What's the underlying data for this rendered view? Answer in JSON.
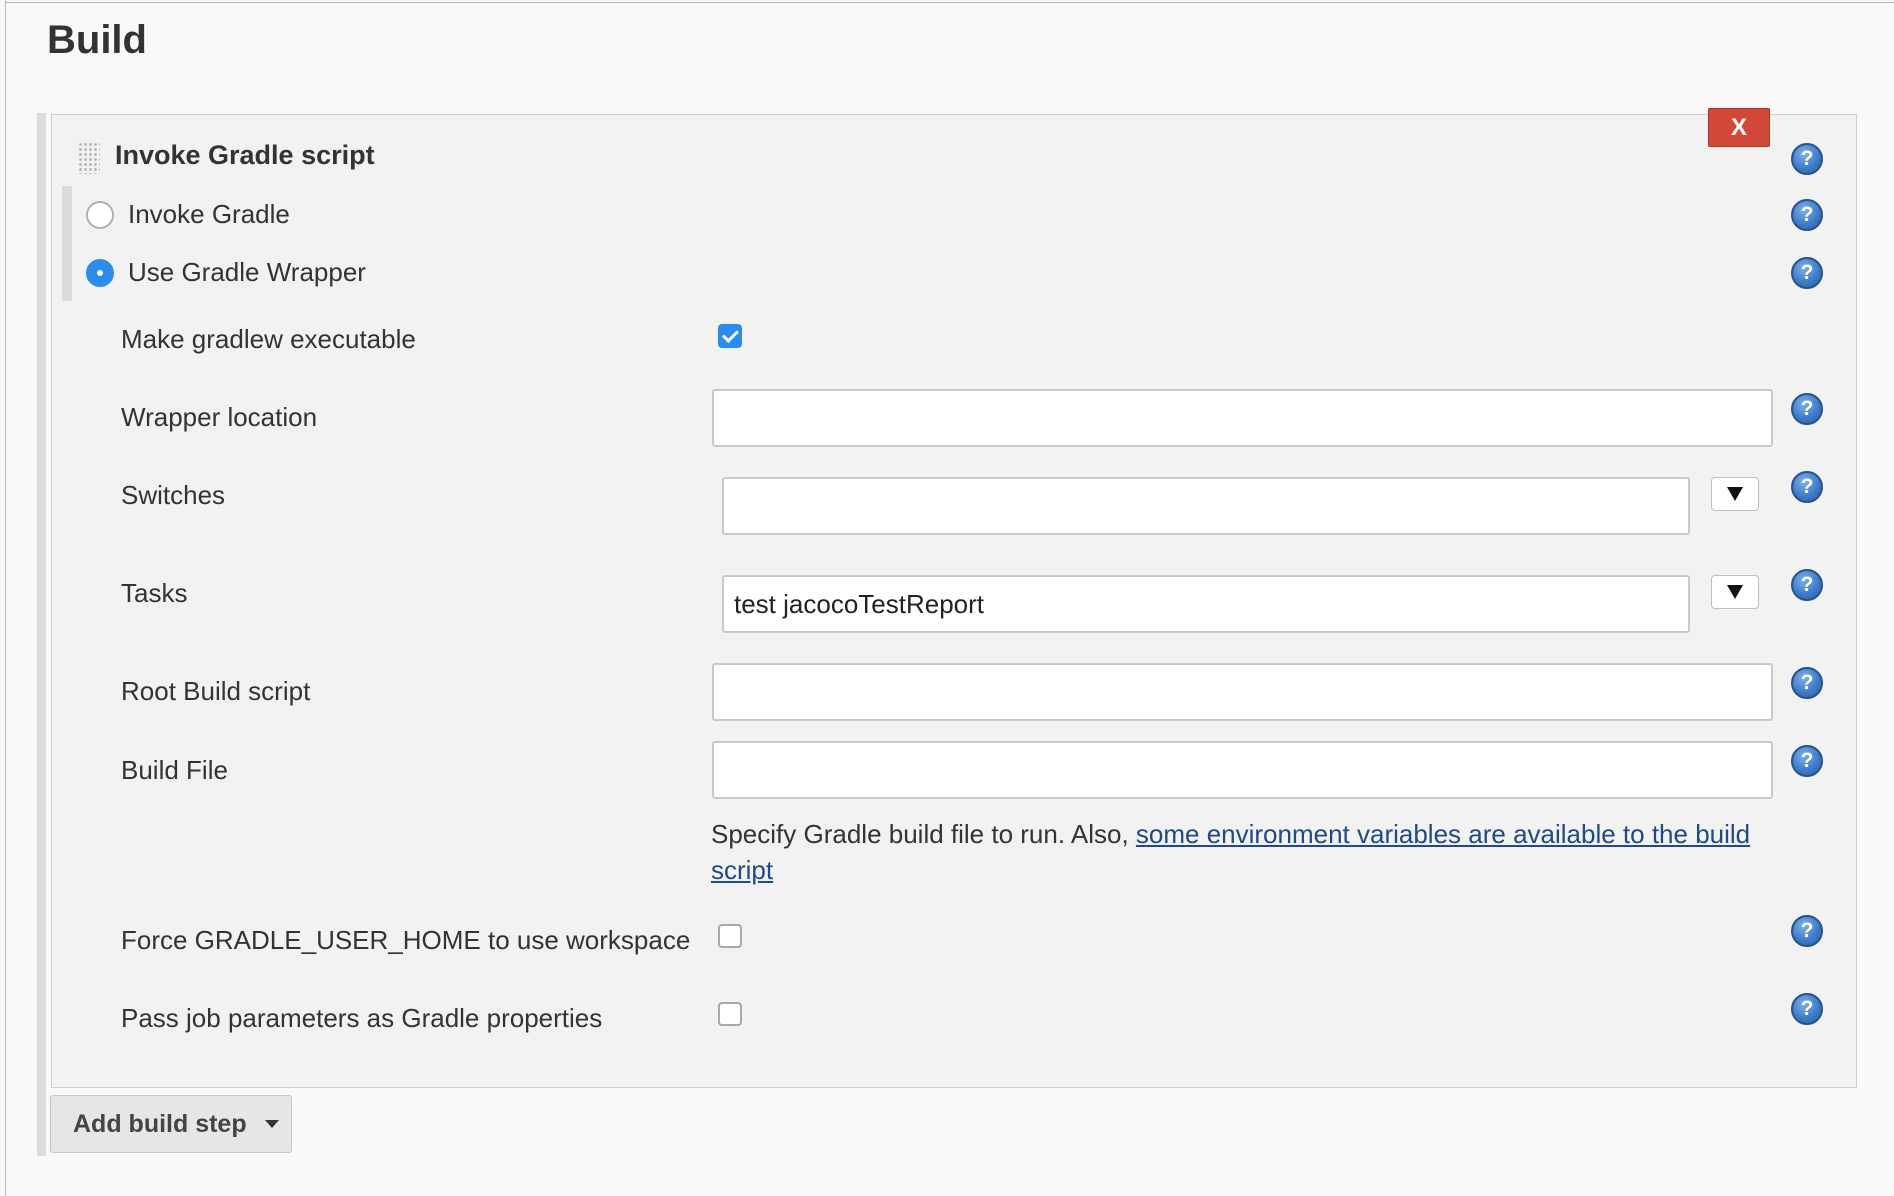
{
  "section": {
    "title": "Build"
  },
  "build_step": {
    "title": "Invoke Gradle script",
    "delete_label": "X",
    "help_symbol": "?",
    "radio_options": [
      {
        "label": "Invoke Gradle",
        "checked": false
      },
      {
        "label": "Use Gradle Wrapper",
        "checked": true
      }
    ],
    "fields": {
      "make_gradlew_executable": {
        "label": "Make gradlew executable",
        "checked": true
      },
      "wrapper_location": {
        "label": "Wrapper location",
        "value": ""
      },
      "switches": {
        "label": "Switches",
        "value": ""
      },
      "tasks": {
        "label": "Tasks",
        "value": "test jacocoTestReport"
      },
      "root_build_script": {
        "label": "Root Build script",
        "value": ""
      },
      "build_file": {
        "label": "Build File",
        "value": ""
      },
      "force_gradle_user_home": {
        "label": "Force GRADLE_USER_HOME to use workspace",
        "checked": false
      },
      "pass_job_parameters": {
        "label": "Pass job parameters as Gradle properties",
        "checked": false
      }
    },
    "build_file_help": {
      "text": "Specify Gradle build file to run. Also, ",
      "link_text": "some environment variables are available to the build script"
    }
  },
  "add_step": {
    "label": "Add build step"
  },
  "colors": {
    "delete_button": "#d24939",
    "accent_blue": "#2c8ceb",
    "link": "#204a87",
    "help_icon": "#3f7dc9"
  },
  "icons": [
    "drag-handle-icon",
    "help-icon",
    "dropdown-arrow-icon",
    "caret-down-icon"
  ]
}
